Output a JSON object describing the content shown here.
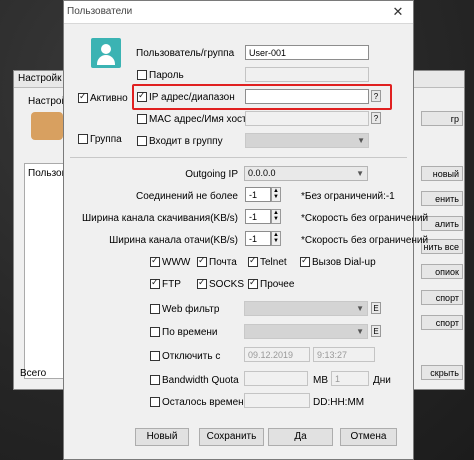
{
  "back_window": {
    "title": "Настройк",
    "subtitle": "Настрой",
    "list_header": "Пользов",
    "total": "Всего",
    "right_buttons": [
      "гр",
      "новый",
      "енить",
      "алить",
      "нить все",
      "опиок",
      "спорт",
      "спорт",
      "скрыть"
    ]
  },
  "dialog": {
    "title": "Пользователи",
    "user_group_label": "Пользователь/группа",
    "user_group_value": "User-001",
    "active_label": "Активно",
    "group_label": "Группа",
    "password_label": "Пароль",
    "ip_label": "IP адрес/диапазон",
    "ip_value": "",
    "q": "?",
    "mac_label": "MAC адрес/Имя хоста",
    "join_group_label": "Входит в группу",
    "outgoing_ip_label": "Outgoing IP",
    "outgoing_ip_value": "0.0.0.0",
    "conn_label": "Соединений не более",
    "conn_value": "-1",
    "conn_note": "*Без ограничений:-1",
    "down_label": "Ширина канала скачивания(KB/s)",
    "down_value": "-1",
    "down_note": "*Скорость без ограничений",
    "up_label": "Ширина канала отачи(KB/s)",
    "up_value": "-1",
    "up_note": "*Скорость без ограничений",
    "services": [
      "WWW",
      "Почта",
      "Telnet",
      "Вызов Dial-up",
      "FTP",
      "SOCKS",
      "Прочее"
    ],
    "web_filter_label": "Web фильтр",
    "time_label": "По времени",
    "e": "E",
    "disable_label": "Отключить с",
    "disable_date": "09.12.2019",
    "disable_time": "9:13:27",
    "quota_label": "Bandwidth Quota",
    "quota_unit": "MB",
    "quota_days": "1",
    "quota_days_label": "Дни",
    "remain_label": "Осталось времени",
    "remain_format": "DD:HH:MM",
    "btn_new": "Новый",
    "btn_save": "Сохранить",
    "btn_yes": "Да",
    "btn_cancel": "Отмена",
    "close": "✕"
  },
  "colors": {
    "highlight": "#e02020",
    "avatar": "#3bb3b3"
  }
}
